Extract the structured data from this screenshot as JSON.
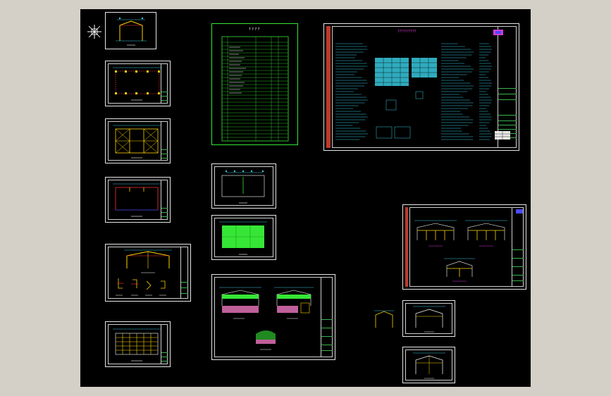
{
  "colors": {
    "background": "#000000",
    "chrome": "#d4d0c8",
    "sheet_border": "#e6e6e6",
    "green": "#36e636",
    "cyan": "#38c9e0",
    "yellow": "#ffd400",
    "red": "#ff3030",
    "blue": "#4a4aff",
    "magenta": "#d63ad6"
  },
  "drawing_list": {
    "title": "? ? ? ?"
  },
  "design_notes": {
    "title": "??????????"
  },
  "icons": {
    "ucs": "ucs-axis-icon",
    "logo": "company-logo-icon"
  }
}
